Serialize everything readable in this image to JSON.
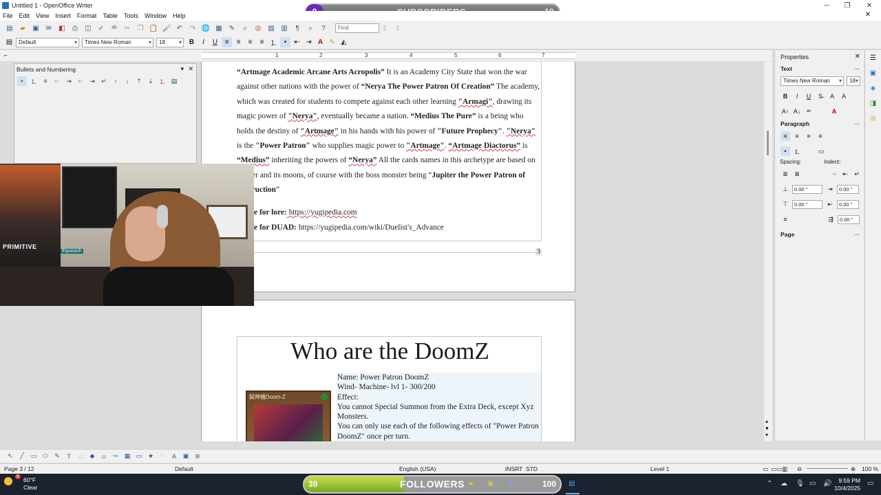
{
  "window": {
    "title": "Untitled 1 - OpenOffice Writer",
    "minimize": "─",
    "maximize": "❐",
    "close": "✕"
  },
  "subscribers": {
    "count_left": "0",
    "label": "SUBSCRIBERS",
    "goal": "10",
    "accent": "#6b2bb8"
  },
  "menu": {
    "items": [
      "File",
      "Edit",
      "View",
      "Insert",
      "Format",
      "Table",
      "Tools",
      "Window",
      "Help"
    ],
    "close_doc": "✕"
  },
  "toolbar": {
    "find_placeholder": "Find"
  },
  "format_bar": {
    "style": "Default",
    "font": "Times New Roman",
    "size": "18",
    "bold": "B",
    "italic": "I",
    "underline": "U"
  },
  "ruler": {
    "numbers": [
      "1",
      "2",
      "3",
      "4",
      "5",
      "6",
      "7"
    ]
  },
  "bullets_panel": {
    "title": "Bullets and Numbering"
  },
  "document": {
    "page1": {
      "paragraph_parts": [
        "“Artmage Academic Arcane Arts Acropolis”",
        " It is an Academy City State that won the war against other nations with the power of ",
        "“Nerya The Power Patron Of Creation”",
        " The academy, which was created for students to compete against each other learning ",
        "\"Armagi\"",
        ", drawing its magic power of ",
        "\"Nerya\"",
        ", eventually became a nation. ",
        "“Medius The Pure”",
        " is a being who holds the destiny of ",
        "\"Artmage\"",
        " in his hands with his power of ",
        "\"Future Prophecy\"",
        ". ",
        "\"Nerya\"",
        " is the ",
        "\"Power Patron\"",
        " who supplies magic power to ",
        "\"Artmage\"",
        ". ",
        "“Artmage Diactorus”",
        " is ",
        "“Medius”",
        " inheriting the powers of ",
        "“Nerya”",
        " All the cards names in this archetype are based on Jupiter and its moons, of course with the boss monster being “",
        "Jupiter the Power Patron of Destruction",
        "”"
      ],
      "source_lore_label": "ce for lore:",
      "source_lore_value": " https://yugipedia.com",
      "source_duad_label": "ce for DUAD:",
      "source_duad_value": " https://yugipedia.com/wiki/Duelist's_Advance",
      "page_number": "3"
    },
    "page2": {
      "heading": "Who are the DoomZ",
      "card_name_img": "獄神機Doom-Z",
      "info_lines": [
        "Name: Power Patron DoomZ",
        "Wind- Machine- lvl 1- 300/200",
        "Effect:",
        "You cannot Special Summon from the Extra Deck, except Xyz Monsters.",
        "You can only use each of the following effects of \"Power Patron DoomZ\" once per turn."
      ]
    }
  },
  "webcam": {
    "poster_text": "PRIMITIVE",
    "tag": "Equisoch"
  },
  "sidebar": {
    "title": "Properties",
    "text_section": "Text",
    "font": "Times New Roman",
    "size": "18",
    "paragraph_section": "Paragraph",
    "spacing_label": "Spacing:",
    "indent_label": "Indent:",
    "above": "0.00 \"",
    "below": "0.00 \"",
    "before": "0.00 \"",
    "after": "0.00 \"",
    "first_line": "0.00 \"",
    "line_spacing": "0.00 \"",
    "page_section": "Page",
    "more": "⋯"
  },
  "status": {
    "page": "Page 3 / 12",
    "style": "Default",
    "language": "English (USA)",
    "insert": "INSRT",
    "selection": "STD",
    "level": "Level 1",
    "zoom": "100 %"
  },
  "taskbar": {
    "temperature": "60°F",
    "condition": "Clear",
    "followers_left": "39",
    "followers_label": "FOLLOWERS",
    "followers_goal": "100",
    "followers_progress": 0.39,
    "time": "9:59 PM",
    "date": "10/4/2025",
    "weather_badge": "6"
  }
}
